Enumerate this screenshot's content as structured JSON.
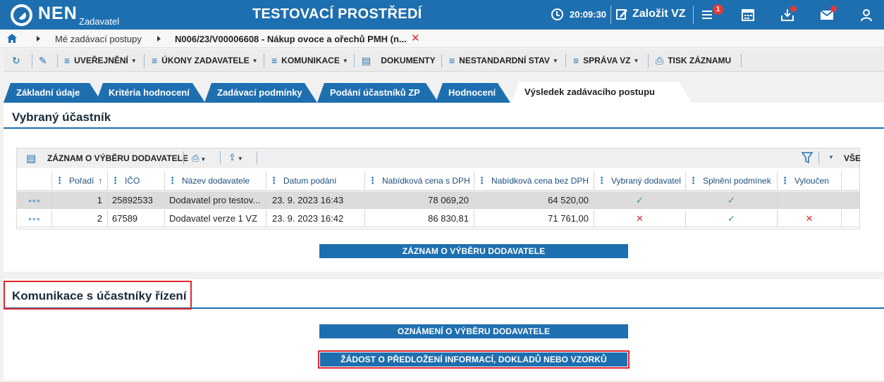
{
  "header": {
    "logo": "NEN",
    "logo_sub": "Zadavatel",
    "app_title": "TESTOVACÍ PROSTŘEDÍ",
    "time": "20:09:30",
    "create_label": "Založit VZ",
    "notification_count": "1",
    "accent_color": "#1e6fb0"
  },
  "breadcrumb": {
    "item1": "Mé zadávací postupy",
    "item2": "N006/23/V00006608 - Nákup ovoce a ořechů PMH (n...",
    "close": "✕"
  },
  "toolbar": {
    "uverejneni": "UVEŘEJNĚNÍ",
    "ukony": "ÚKONY ZADAVATELE",
    "komunikace": "KOMUNIKACE",
    "dokumenty": "DOKUMENTY",
    "nestandardni": "NESTANDARDNÍ STAV",
    "sprava": "SPRÁVA VZ",
    "tisk": "TISK ZÁZNAMU"
  },
  "tabs": [
    {
      "label": "Základní údaje"
    },
    {
      "label": "Kritéria hodnocení"
    },
    {
      "label": "Zadávací podmínky"
    },
    {
      "label": "Podání účastníků ZP"
    },
    {
      "label": "Hodnocení"
    },
    {
      "label": "Výsledek zadávacího postupu"
    }
  ],
  "section1": {
    "title": "Vybraný účastník",
    "grid_title": "ZÁZNAM O VÝBĚRU DODAVATELE",
    "filter_all": "VŠE",
    "columns": [
      "Pořadí",
      "IČO",
      "Název dodavatele",
      "Datum podání",
      "Nabídková cena s DPH",
      "Nabídková cena bez DPH",
      "Vybraný dodavatel",
      "Splnění podmínek",
      "Vyloučen"
    ],
    "rows": [
      {
        "poradi": "1",
        "ico": "25892533",
        "nazev": "Dodavatel pro testov...",
        "datum": "23. 9. 2023 16:43",
        "s_dph": "78 069,20",
        "bez_dph": "64 520,00",
        "vybrany": "✓",
        "splneni": "✓",
        "vyloucen": ""
      },
      {
        "poradi": "2",
        "ico": "67589",
        "nazev": "Dodavatel verze 1 VZ",
        "datum": "23. 9. 2023 16:42",
        "s_dph": "86 830,81",
        "bez_dph": "71 761,00",
        "vybrany": "✕",
        "splneni": "✓",
        "vyloucen": "✕"
      }
    ],
    "row_menu": "∘∘∘",
    "button": "ZÁZNAM O VÝBĚRU DODAVATELE"
  },
  "section2": {
    "title": "Komunikace s účastníky řízení",
    "button1": "OZNÁMENÍ O VÝBĚRU DODAVATELE",
    "button2": "ŽÁDOST O PŘEDLOŽENÍ INFORMACÍ, DOKLADŮ NEBO VZORKŮ"
  }
}
